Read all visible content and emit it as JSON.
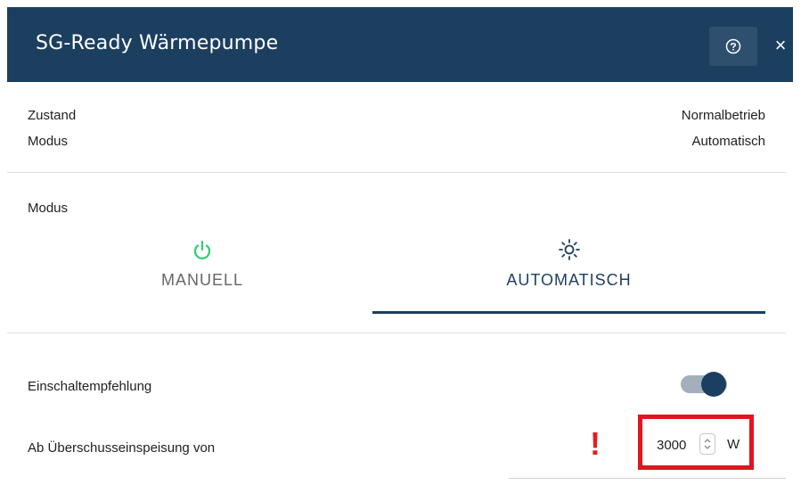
{
  "dialog": {
    "title": "SG-Ready Wärmepumpe",
    "help_icon": "help-circle-icon",
    "close_label": "×"
  },
  "status": {
    "rows": [
      {
        "label": "Zustand",
        "value": "Normalbetrieb"
      },
      {
        "label": "Modus",
        "value": "Automatisch"
      }
    ]
  },
  "mode": {
    "heading": "Modus",
    "tabs": [
      {
        "label": "MANUELL",
        "icon": "power-icon",
        "icon_color": "#2ecc71",
        "active": false
      },
      {
        "label": "AUTOMATISCH",
        "icon": "sun-icon",
        "icon_color": "#1d3f5f",
        "active": true
      }
    ]
  },
  "settings": {
    "recommendation_label": "Einschaltempfehlung",
    "recommendation_enabled": true,
    "threshold_label": "Ab Überschusseinspeisung von",
    "threshold_value": "3000",
    "threshold_unit": "W",
    "warning_mark": "!"
  },
  "colors": {
    "header_bg": "#1d3f5f",
    "accent": "#1d3f5f",
    "warning": "#e02020",
    "highlight": "#e3141d"
  }
}
